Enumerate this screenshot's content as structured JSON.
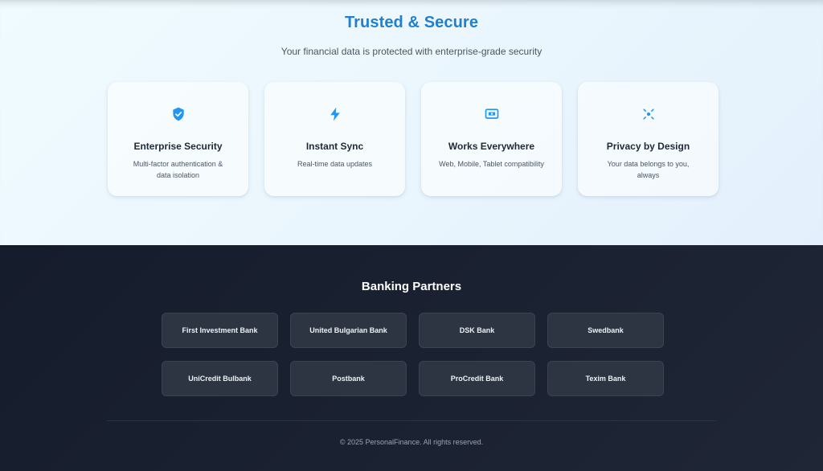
{
  "trust": {
    "title": "Trusted & Secure",
    "subtitle": "Your financial data is protected with enterprise-grade security",
    "accent_color": "#1f7fd1",
    "cards": [
      {
        "icon": "shield-check-icon",
        "title": "Enterprise Security",
        "description": "Multi-factor authentication & data isolation"
      },
      {
        "icon": "lightning-bolt-icon",
        "title": "Instant Sync",
        "description": "Real-time data updates"
      },
      {
        "icon": "device-screen-icon",
        "title": "Works Everywhere",
        "description": "Web, Mobile, Tablet compatibility"
      },
      {
        "icon": "privacy-focus-icon",
        "title": "Privacy by Design",
        "description": "Your data belongs to you, always"
      }
    ]
  },
  "partners": {
    "title": "Banking Partners",
    "banks": [
      "First Investment Bank",
      "United Bulgarian Bank",
      "DSK Bank",
      "Swedbank",
      "UniCredit Bulbank",
      "Postbank",
      "ProCredit Bank",
      "Texim Bank"
    ]
  },
  "footer": {
    "copyright": "© 2025 PersonalFinance. All rights reserved."
  }
}
